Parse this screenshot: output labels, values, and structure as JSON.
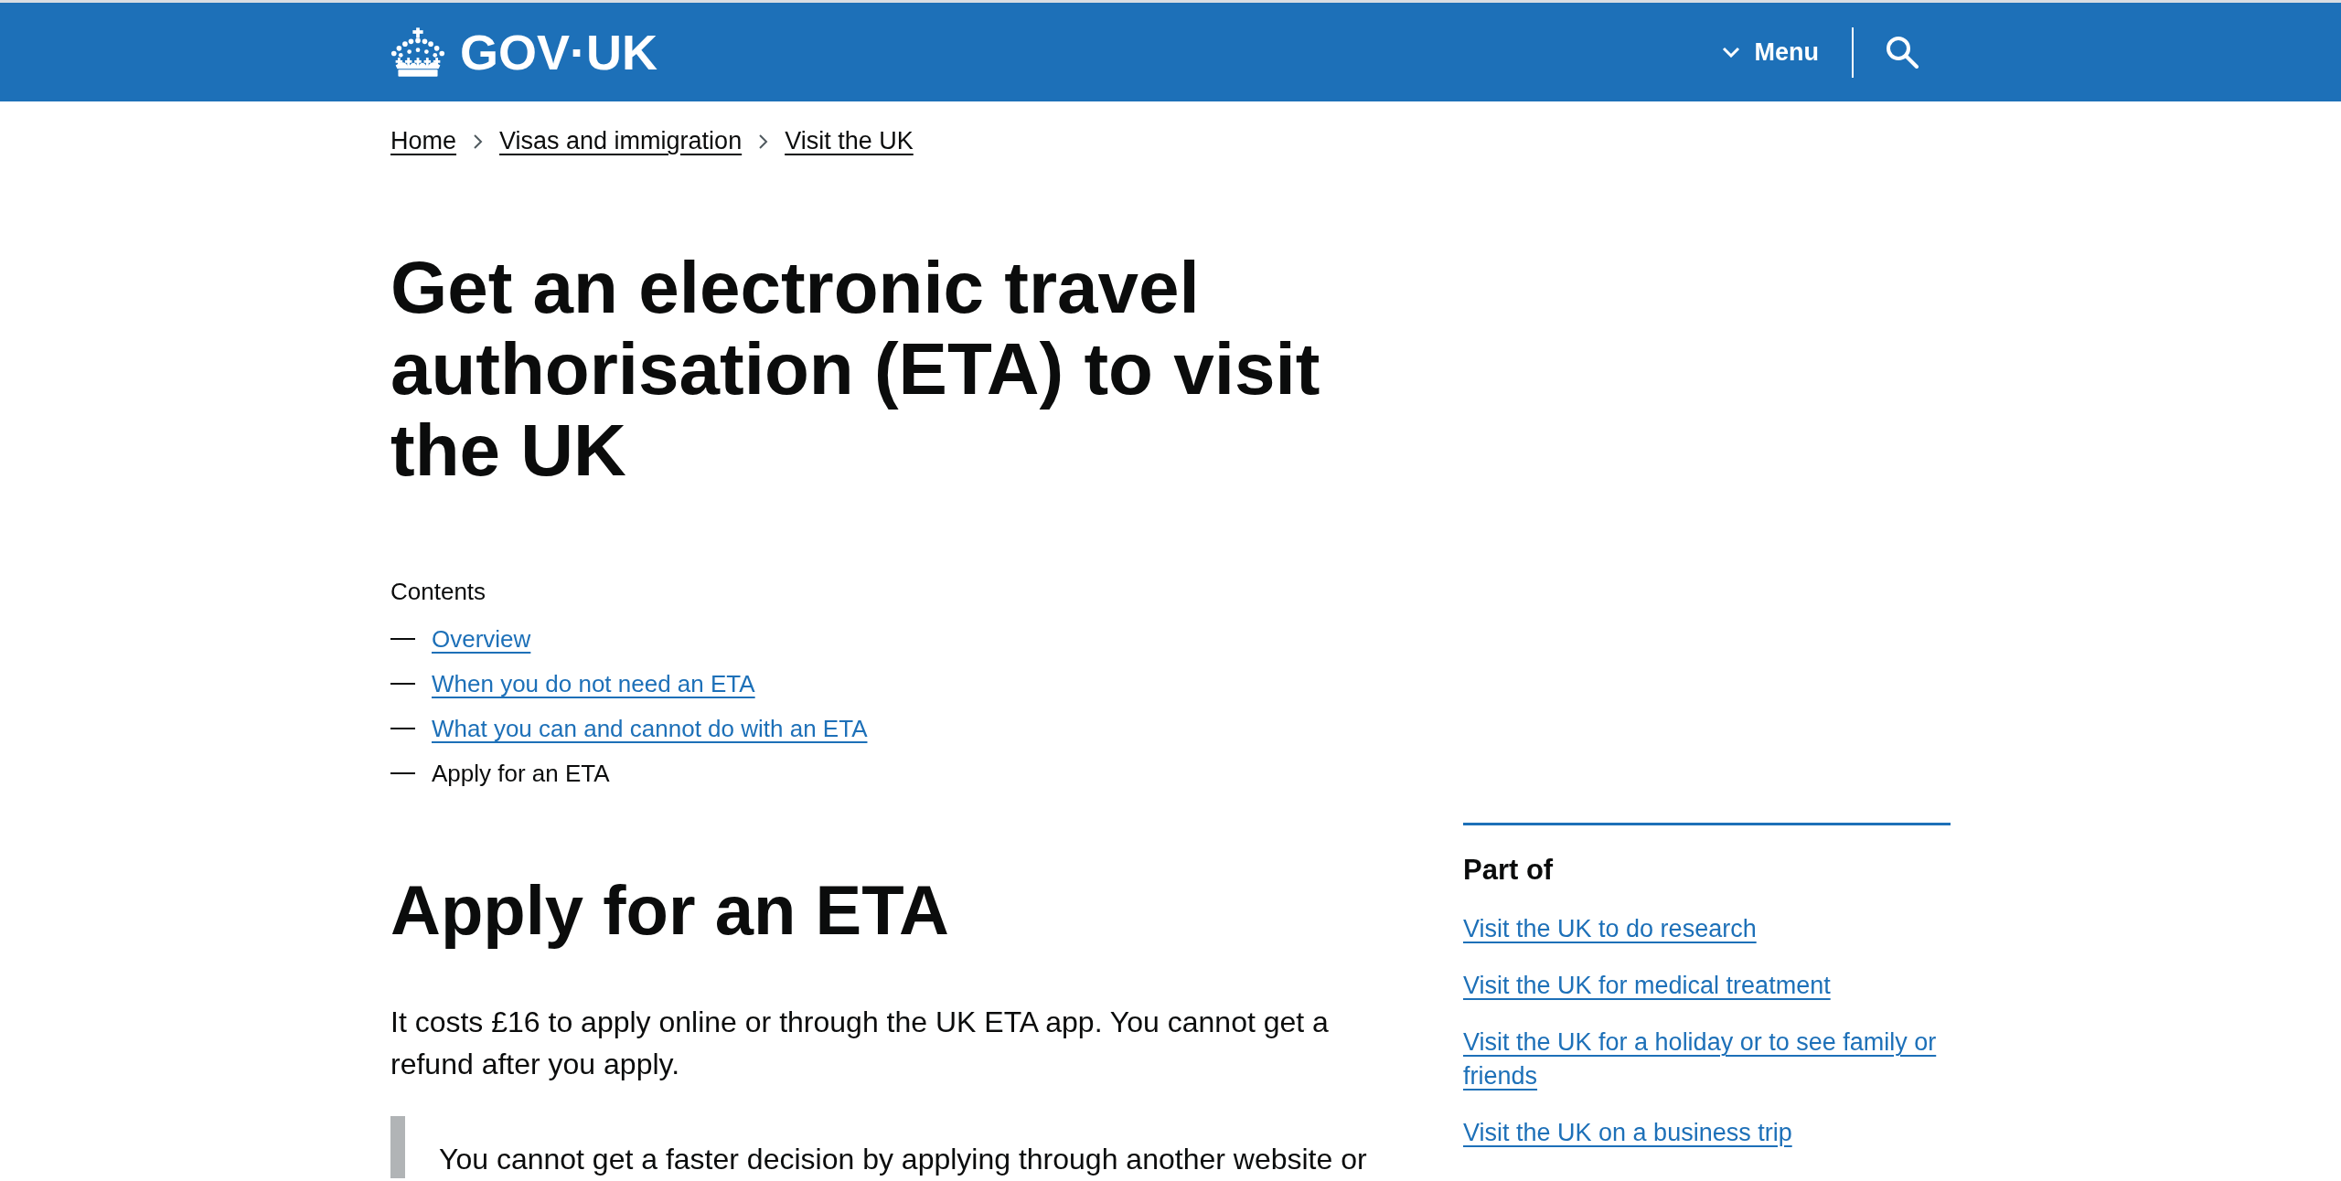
{
  "header": {
    "logo": "GOV·UK",
    "menu_button": "Menu"
  },
  "breadcrumbs": [
    "Home",
    "Visas and immigration",
    "Visit the UK"
  ],
  "title": "Get an electronic travel authorisation (ETA) to visit the UK",
  "contents": {
    "heading": "Contents",
    "items": [
      {
        "label": "Overview",
        "selected": false
      },
      {
        "label": "When you do not need an ETA",
        "selected": false
      },
      {
        "label": "What you can and cannot do with an ETA",
        "selected": false
      },
      {
        "label": "Apply for an ETA",
        "selected": true
      }
    ]
  },
  "section": {
    "heading": "Apply for an ETA",
    "paragraph": "It costs £16 to apply online or through the UK ETA app. You cannot get a refund after you apply.",
    "inset_text": "You cannot get a faster decision by applying through another website or"
  },
  "related": {
    "heading": "Part of",
    "links": [
      "Visit the UK to do research",
      "Visit the UK for medical treatment",
      "Visit the UK for a holiday or to see family or friends",
      "Visit the UK on a business trip"
    ]
  }
}
